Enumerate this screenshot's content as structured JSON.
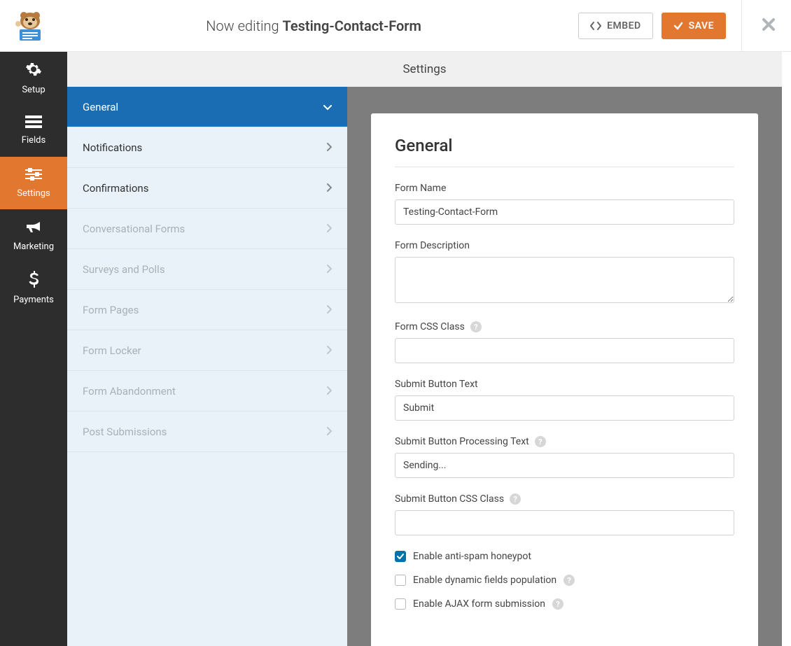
{
  "header": {
    "now_editing_prefix": "Now editing ",
    "form_title": "Testing-Contact-Form",
    "embed_label": "EMBED",
    "save_label": "SAVE"
  },
  "rail": {
    "items": [
      {
        "label": "Setup",
        "icon": "gear"
      },
      {
        "label": "Fields",
        "icon": "list"
      },
      {
        "label": "Settings",
        "icon": "sliders",
        "active": true
      },
      {
        "label": "Marketing",
        "icon": "bullhorn"
      },
      {
        "label": "Payments",
        "icon": "dollar"
      }
    ]
  },
  "settings_title": "Settings",
  "sublist": [
    {
      "label": "General",
      "active": true
    },
    {
      "label": "Notifications"
    },
    {
      "label": "Confirmations"
    },
    {
      "label": "Conversational Forms",
      "dim": true
    },
    {
      "label": "Surveys and Polls",
      "dim": true
    },
    {
      "label": "Form Pages",
      "dim": true
    },
    {
      "label": "Form Locker",
      "dim": true
    },
    {
      "label": "Form Abandonment",
      "dim": true
    },
    {
      "label": "Post Submissions",
      "dim": true
    }
  ],
  "panel": {
    "title": "General",
    "form_name_label": "Form Name",
    "form_name_value": "Testing-Contact-Form",
    "form_desc_label": "Form Description",
    "form_desc_value": "",
    "css_class_label": "Form CSS Class",
    "css_class_value": "",
    "submit_text_label": "Submit Button Text",
    "submit_text_value": "Submit",
    "submit_processing_label": "Submit Button Processing Text",
    "submit_processing_value": "Sending...",
    "submit_css_label": "Submit Button CSS Class",
    "submit_css_value": "",
    "chk_honeypot": "Enable anti-spam honeypot",
    "chk_dynamic": "Enable dynamic fields population",
    "chk_ajax": "Enable AJAX form submission"
  }
}
